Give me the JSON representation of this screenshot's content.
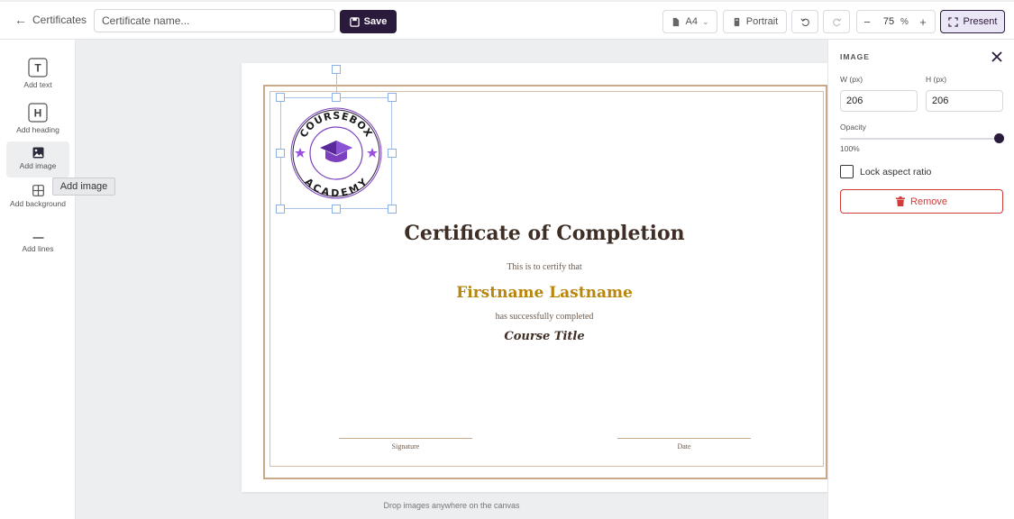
{
  "topbar": {
    "back_label": "Certificates",
    "name_placeholder": "Certificate name...",
    "save_label": "Save",
    "page_size": "A4",
    "orientation": "Portrait",
    "zoom_value": "75",
    "zoom_unit": "%",
    "zoom_minus": "−",
    "zoom_plus": "+",
    "present_label": "Present"
  },
  "tools": {
    "add_text": "Add text",
    "add_heading": "Add heading",
    "add_image": "Add image",
    "add_background": "Add background",
    "add_lines": "Add lines",
    "tooltip": "Add image"
  },
  "certificate": {
    "title": "Certificate of Completion",
    "subtitle": "This is to certify that",
    "name": "Firstname Lastname",
    "completed": "has successfully completed",
    "course": "Course Title",
    "signature_label": "Signature",
    "date_label": "Date",
    "logo_top_text": "COURSEBOX",
    "logo_bottom_text": "ACADEMY"
  },
  "drop_hint": "Drop images anywhere on the canvas",
  "panel": {
    "title": "IMAGE",
    "width_label": "W (px)",
    "height_label": "H (px)",
    "width_value": "206",
    "height_value": "206",
    "opacity_label": "Opacity",
    "opacity_value": "100%",
    "opacity_fraction": 1.0,
    "lock_label": "Lock aspect ratio",
    "lock_checked": false,
    "remove_label": "Remove"
  },
  "colors": {
    "primary": "#2a1a3c",
    "accent_gold": "#b8860b",
    "danger": "#d33a3a",
    "logo_purple": "#7b3fbf"
  }
}
